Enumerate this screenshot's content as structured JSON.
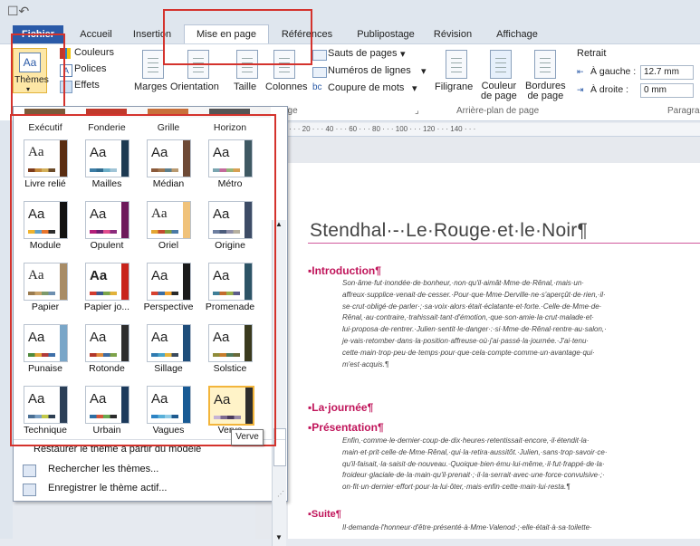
{
  "qat": {
    "text": "☐↶"
  },
  "tabs": [
    {
      "label": "Fichier"
    },
    {
      "label": "Accueil"
    },
    {
      "label": "Insertion"
    },
    {
      "label": "Mise en page"
    },
    {
      "label": "Références"
    },
    {
      "label": "Publipostage"
    },
    {
      "label": "Révision"
    },
    {
      "label": "Affichage"
    }
  ],
  "ribbon": {
    "themes_label": "Thèmes",
    "colors_label": "Couleurs",
    "fonts_label": "Polices",
    "effects_label": "Effets",
    "margins_label": "Marges",
    "orientation_label": "Orientation",
    "size_label": "Taille",
    "columns_label": "Colonnes",
    "page_breaks_label": "Sauts de pages",
    "line_numbers_label": "Numéros de lignes",
    "hyphenation_label": "Coupure de mots",
    "group_page_suffix": "age",
    "watermark_label": "Filigrane",
    "page_color_label": "Couleur\nde page",
    "page_borders_label": "Bordures\nde page",
    "background_group": "Arrière-plan de page",
    "indent_title": "Retrait",
    "left_label": "À gauche :",
    "left_value": "12.7 mm",
    "right_label": "À droite :",
    "right_value": "0 mm",
    "paragraph_group": "Paragra"
  },
  "ruler": {
    "text": "· · · 20 · · · 40 · · · 60 · · · 80 · · · 100 · · · 120 · · · 140 · · ·"
  },
  "themes": {
    "top_row": [
      "Exécutif",
      "Fonderie",
      "Grille",
      "Horizon"
    ],
    "rows": [
      [
        {
          "name": "Livre relié",
          "font": "serif",
          "colors": [
            "#7d3b1b",
            "#c48a3c",
            "#d3b05a",
            "#6b4b2a"
          ],
          "side": "#5a2d12"
        },
        {
          "name": "Mailles",
          "font": "sans",
          "colors": [
            "#3c7da5",
            "#2f6b8f",
            "#6eb0c9",
            "#a0c4d6"
          ],
          "side": "#1d3a52"
        },
        {
          "name": "Médian",
          "font": "sans",
          "colors": [
            "#8a5a3b",
            "#a0764e",
            "#5c7f8d",
            "#b99a70"
          ],
          "side": "#6e4a36"
        },
        {
          "name": "Métro",
          "font": "sans",
          "colors": [
            "#7aa5b0",
            "#c46a9b",
            "#95b67a",
            "#d7a053"
          ],
          "side": "#3f5963"
        }
      ],
      [
        {
          "name": "Module",
          "font": "sans",
          "colors": [
            "#f0b32c",
            "#5fa0c9",
            "#e7742c",
            "#2d2d2d"
          ],
          "side": "#111111"
        },
        {
          "name": "Opulent",
          "font": "sans",
          "colors": [
            "#b31f7a",
            "#6f1e6f",
            "#e14d8f",
            "#8a2b7c"
          ],
          "side": "#6d1a5c"
        },
        {
          "name": "Oriel",
          "font": "serif",
          "colors": [
            "#e4a632",
            "#c34b2f",
            "#7f9c3e",
            "#4a7aa6"
          ],
          "side": "#f0c27a"
        },
        {
          "name": "Origine",
          "font": "sans",
          "colors": [
            "#6d7fa0",
            "#4b5c7c",
            "#8f8fa8",
            "#b6b0a0"
          ],
          "side": "#3d4c66"
        }
      ],
      [
        {
          "name": "Papier",
          "font": "serif",
          "colors": [
            "#9a7b4f",
            "#c9a36b",
            "#7d9a6b",
            "#6d8fb0"
          ],
          "side": "#a88c66"
        },
        {
          "name": "Papier jo...",
          "font": "bold",
          "colors": [
            "#d23b2f",
            "#3b5b8f",
            "#7aa54a",
            "#e2b23a"
          ],
          "side": "#c8241c"
        },
        {
          "name": "Perspective",
          "font": "sans",
          "colors": [
            "#d8412f",
            "#3a6ea5",
            "#f0a02c",
            "#2a2a2a"
          ],
          "side": "#1a1a1a"
        },
        {
          "name": "Promenade",
          "font": "sans",
          "colors": [
            "#3f7f98",
            "#c36d2d",
            "#98b04a",
            "#5c5c8a"
          ],
          "side": "#2d5466"
        }
      ],
      [
        {
          "name": "Punaise",
          "font": "sans",
          "colors": [
            "#4f8a3c",
            "#e2a437",
            "#b13a3a",
            "#3d6fa8"
          ],
          "side": "#7aa6c8"
        },
        {
          "name": "Rotonde",
          "font": "sans",
          "colors": [
            "#b1372a",
            "#e08a3a",
            "#3f6aa0",
            "#7ea34a"
          ],
          "side": "#2d2d2d"
        },
        {
          "name": "Sillage",
          "font": "sans",
          "colors": [
            "#2f7ab0",
            "#4aa5c9",
            "#e6b43a",
            "#3a4a5c"
          ],
          "side": "#1e4d7a"
        },
        {
          "name": "Solstice",
          "font": "sans",
          "colors": [
            "#8f8c3a",
            "#c77d2c",
            "#4d7a5c",
            "#6a6a3a"
          ],
          "side": "#3a3a1e"
        }
      ],
      [
        {
          "name": "Technique",
          "font": "sans",
          "colors": [
            "#4a6f94",
            "#7aa0c4",
            "#c2c94a",
            "#2d3e52"
          ],
          "side": "#2b3f57"
        },
        {
          "name": "Urbain",
          "font": "sans",
          "colors": [
            "#2e6fa3",
            "#d3553a",
            "#6aa84f",
            "#2b2b2b"
          ],
          "side": "#1c3a5c"
        },
        {
          "name": "Vagues",
          "font": "sans",
          "colors": [
            "#2d83c4",
            "#59b0d9",
            "#8fcbe6",
            "#1e5a8f"
          ],
          "side": "#185a94"
        },
        {
          "name": "Verve",
          "font": "sans",
          "colors": [
            "#c5b3d5",
            "#7d6a8f",
            "#4a3a5c",
            "#9a8aa8"
          ],
          "side": "#2d2d2d"
        }
      ]
    ]
  },
  "tooltip": "Verve",
  "menu": {
    "restore": "Restaurer le thème à partir du modèle",
    "search": "Rechercher les thèmes...",
    "save": "Enregistrer le thème actif..."
  },
  "document": {
    "title": "Stendhal·-·Le·Rouge·et·le·Noir¶",
    "intro_heading": "Introduction¶",
    "intro_lines": [
      "Son·âme·fut·inondée·de·bonheur,·non·qu'il·aimât·Mme·de·Rênal,·mais·un·",
      "affreux·supplice·venait·de·cesser.·Pour·que·Mme·Derville·ne·s'aperçût·de·rien,·il·",
      "se·crut·obligé·de·parler·;·sa·voix·alors·était·éclatante·et·forte.·Celle·de·Mme·de·",
      "Rênal,·au·contraire,·trahissait·tant·d'émotion,·que·son·amie·la·crut·malade·et·",
      "lui·proposa·de·rentrer.·Julien·sentit·le·danger·:·si·Mme·de·Rênal·rentre·au·salon,·",
      "je·vais·retomber·dans·la·position·affreuse·où·j'ai·passé·la·journée.·J'ai·tenu·",
      "cette·main·trop·peu·de·temps·pour·que·cela·compte·comme·un·avantage·qui·",
      "m'est·acquis.¶"
    ],
    "journee_heading": "La·journée¶",
    "presentation_heading": "Présentation¶",
    "presentation_lines": [
      "Enfin,·comme·le·dernier·coup·de·dix·heures·retentissait·encore,·il·étendit·la·",
      "main·et·prit·celle·de·Mme·Rênal,·qui·la·retira·aussitôt.·Julien,·sans·trop·savoir·ce·",
      "qu'il·faisait,·la·saisit·de·nouveau.·Quoique·bien·ému·lui-même,·il·fut·frappé·de·la·",
      "froideur·glaciale·de·la·main·qu'il·prenait·;·il·la·serrait·avec·une·force·convulsive·;·",
      "on·fit·un·dernier·effort·pour·la·lui·ôter,·mais·enfin·cette·main·lui·resta.¶"
    ],
    "suite_heading": "Suite¶",
    "suite_line": "Il·demanda·l'honneur·d'être·présenté·à·Mme·Valenod·;·elle·était·à·sa·toilette·"
  },
  "colors": {
    "accent_red": "#d4332d",
    "heading_pink": "#c0145a",
    "highlight": "#f3b53b"
  }
}
